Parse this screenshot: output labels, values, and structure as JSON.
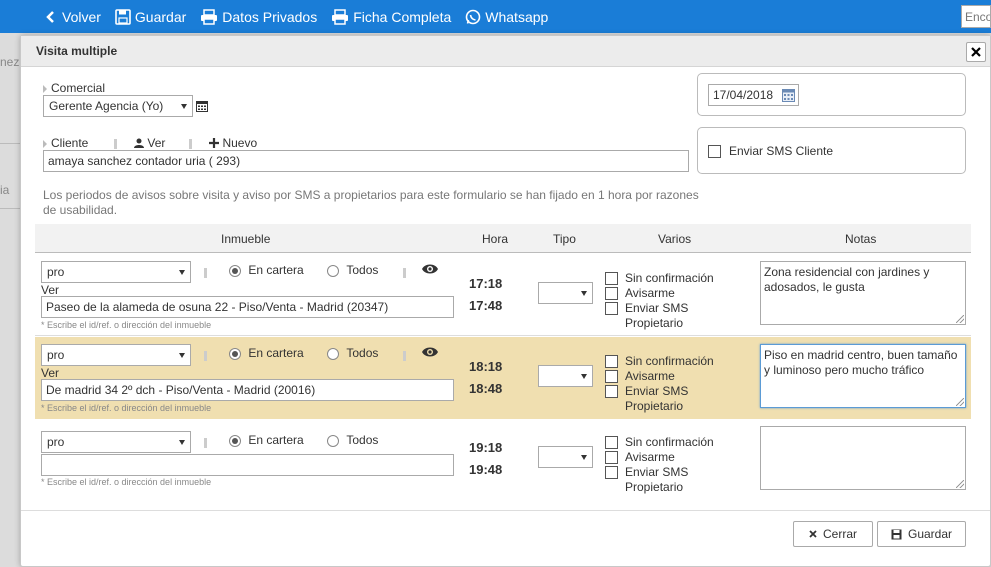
{
  "toolbar": {
    "volver": "Volver",
    "guardar": "Guardar",
    "datos_privados": "Datos Privados",
    "ficha_completa": "Ficha Completa",
    "whatsapp": "Whatsapp",
    "search_placeholder": "Enco"
  },
  "background": {
    "frag1": "nez",
    "frag2": "ia"
  },
  "modal": {
    "title": "Visita multiple",
    "comercial_label": "Comercial",
    "comercial_value": "Gerente Agencia (Yo)",
    "date_value": "17/04/2018",
    "cliente_label": "Cliente",
    "ver_label": "Ver",
    "nuevo_label": "Nuevo",
    "cliente_value": "amaya sanchez contador uria ( 293)",
    "sms_cliente_label": "Enviar SMS Cliente",
    "info": "Los periodos de avisos sobre visita y aviso por SMS a propietarios para este formulario se han fijado en 1 hora por razones de usabilidad.",
    "headers": {
      "inmueble": "Inmueble",
      "hora": "Hora",
      "tipo": "Tipo",
      "varios": "Varios",
      "notas": "Notas"
    },
    "rows": [
      {
        "select": "pro",
        "radio1": "En cartera",
        "radio2": "Todos",
        "ver": "Ver",
        "inmueble": "Paseo de la alameda de osuna 22 - Piso/Venta - Madrid (20347)",
        "note": "* Escribe el id/ref. o dirección del inmueble",
        "hora1": "17:18",
        "hora2": "17:48",
        "opt1": "Sin confirmación",
        "opt2": "Avisarme",
        "opt3": "Enviar SMS Propietario",
        "notas": "Zona residencial con jardines y adosados, le gusta"
      },
      {
        "select": "pro",
        "radio1": "En cartera",
        "radio2": "Todos",
        "ver": "Ver",
        "inmueble": "De madrid 34  2º dch - Piso/Venta - Madrid (20016)",
        "note": "* Escribe el id/ref. o dirección del inmueble",
        "hora1": "18:18",
        "hora2": "18:48",
        "opt1": "Sin confirmación",
        "opt2": "Avisarme",
        "opt3": "Enviar SMS Propietario",
        "notas": "Piso en madrid centro, buen tamaño y luminoso pero mucho tráfico"
      },
      {
        "select": "pro",
        "radio1": "En cartera",
        "radio2": "Todos",
        "inmueble": "",
        "note": "* Escribe el id/ref. o dirección del inmueble",
        "hora1": "19:18",
        "hora2": "19:48",
        "opt1": "Sin confirmación",
        "opt2": "Avisarme",
        "opt3": "Enviar SMS Propietario",
        "notas": ""
      }
    ],
    "cerrar": "Cerrar",
    "guardar": "Guardar"
  },
  "colors": {
    "toolbar": "#1a7dd7",
    "highlight_row": "#f0dfb0"
  }
}
